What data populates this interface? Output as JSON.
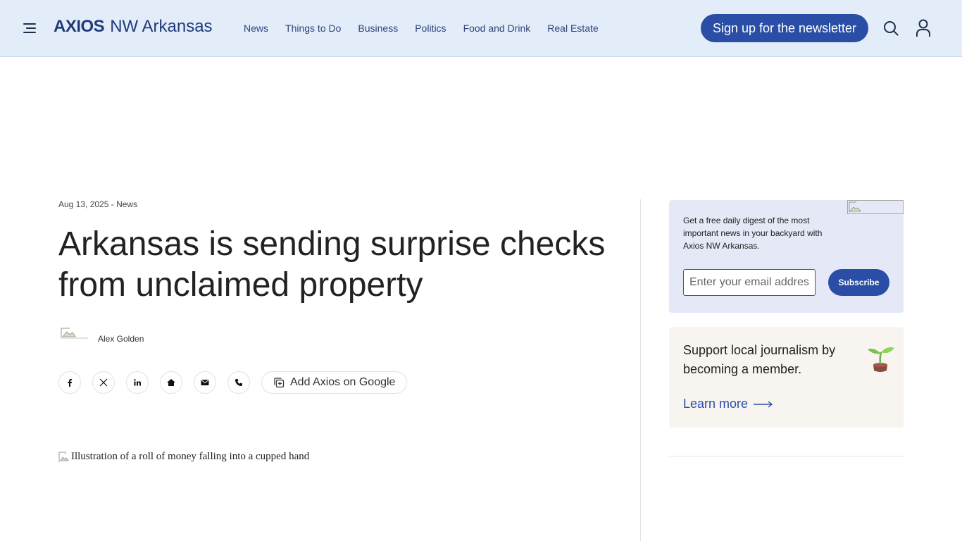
{
  "header": {
    "logo_brand": "AXIOS",
    "logo_city": "NW Arkansas",
    "nav": [
      {
        "label": "News"
      },
      {
        "label": "Things to Do"
      },
      {
        "label": "Business"
      },
      {
        "label": "Politics"
      },
      {
        "label": "Food and Drink"
      },
      {
        "label": "Real Estate"
      }
    ],
    "signup_label": "Sign up for the newsletter",
    "icons": {
      "menu": "menu-icon",
      "search": "search-icon",
      "account": "user-icon"
    }
  },
  "article": {
    "date": "Aug 13, 2025",
    "separator": " - ",
    "section": "News",
    "title": "Arkansas is sending surprise checks from unclaimed property",
    "author": "Alex Golden",
    "share_icons": [
      "facebook-icon",
      "x-icon",
      "linkedin-icon",
      "reddit-icon",
      "email-icon",
      "phone-icon"
    ],
    "add_google_label": "Add Axios on Google",
    "hero_alt": "Illustration of a roll of money falling into a cupped hand"
  },
  "sidebar": {
    "newsletter_text": "Get a free daily digest of the most important news in your backyard with Axios NW Arkansas.",
    "email_placeholder": "Enter your email address",
    "subscribe_label": "Subscribe",
    "member_text": "Support local journalism by becoming a member.",
    "learn_more_label": "Learn more"
  },
  "colors": {
    "header_bg": "#e3edfa",
    "brand_blue": "#2a4ea6",
    "newsletter_bg": "#e4e8f7",
    "member_bg": "#f8f5f1"
  }
}
